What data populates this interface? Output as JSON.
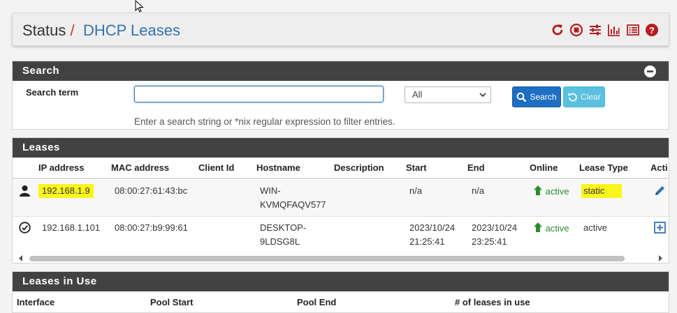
{
  "breadcrumb": {
    "status": "Status",
    "separator": "/",
    "page": "DHCP Leases"
  },
  "toolbar_icons": [
    "restart-icon",
    "stop-icon",
    "sliders-icon",
    "bar-chart-icon",
    "list-icon",
    "help-icon"
  ],
  "colors": {
    "accent_red": "#b51d1d",
    "link_blue": "#3572b0",
    "panel_header": "#424242",
    "online_green": "#2e8b2e",
    "highlight": "#fbf51e"
  },
  "search": {
    "title": "Search",
    "label": "Search term",
    "value": "",
    "placeholder": "",
    "field_selected": "All",
    "search_button": "Search",
    "clear_button": "Clear",
    "hint": "Enter a search string or *nix regular expression to filter entries."
  },
  "leases": {
    "title": "Leases",
    "columns": [
      "IP address",
      "MAC address",
      "Client Id",
      "Hostname",
      "Description",
      "Start",
      "End",
      "Online",
      "Lease Type",
      "Acti"
    ],
    "rows": [
      {
        "type_icon": "user-icon",
        "ip": "192.168.1.9",
        "mac": "08:00:27:61:43:bc",
        "client_id": "",
        "hostname_line1": "WIN-",
        "hostname_line2": "KVMQFAQV577",
        "description": "",
        "start_line1": "n/a",
        "start_line2": "",
        "end_line1": "n/a",
        "end_line2": "",
        "online": "active",
        "lease_type": "static",
        "action_icon": "edit-pencil-icon"
      },
      {
        "type_icon": "check-circle-icon",
        "ip": "192.168.1.101",
        "mac": "08:00:27:b9:99:61",
        "client_id": "",
        "hostname_line1": "DESKTOP-",
        "hostname_line2": "9LDSG8L",
        "description": "",
        "start_line1": "2023/10/24",
        "start_line2": "21:25:41",
        "end_line1": "2023/10/24",
        "end_line2": "23:25:41",
        "online": "active",
        "lease_type": "active",
        "action_icon": "add-square-icon"
      }
    ]
  },
  "inuse": {
    "title": "Leases in Use",
    "columns": [
      "Interface",
      "Pool Start",
      "Pool End",
      "# of leases in use"
    ]
  }
}
